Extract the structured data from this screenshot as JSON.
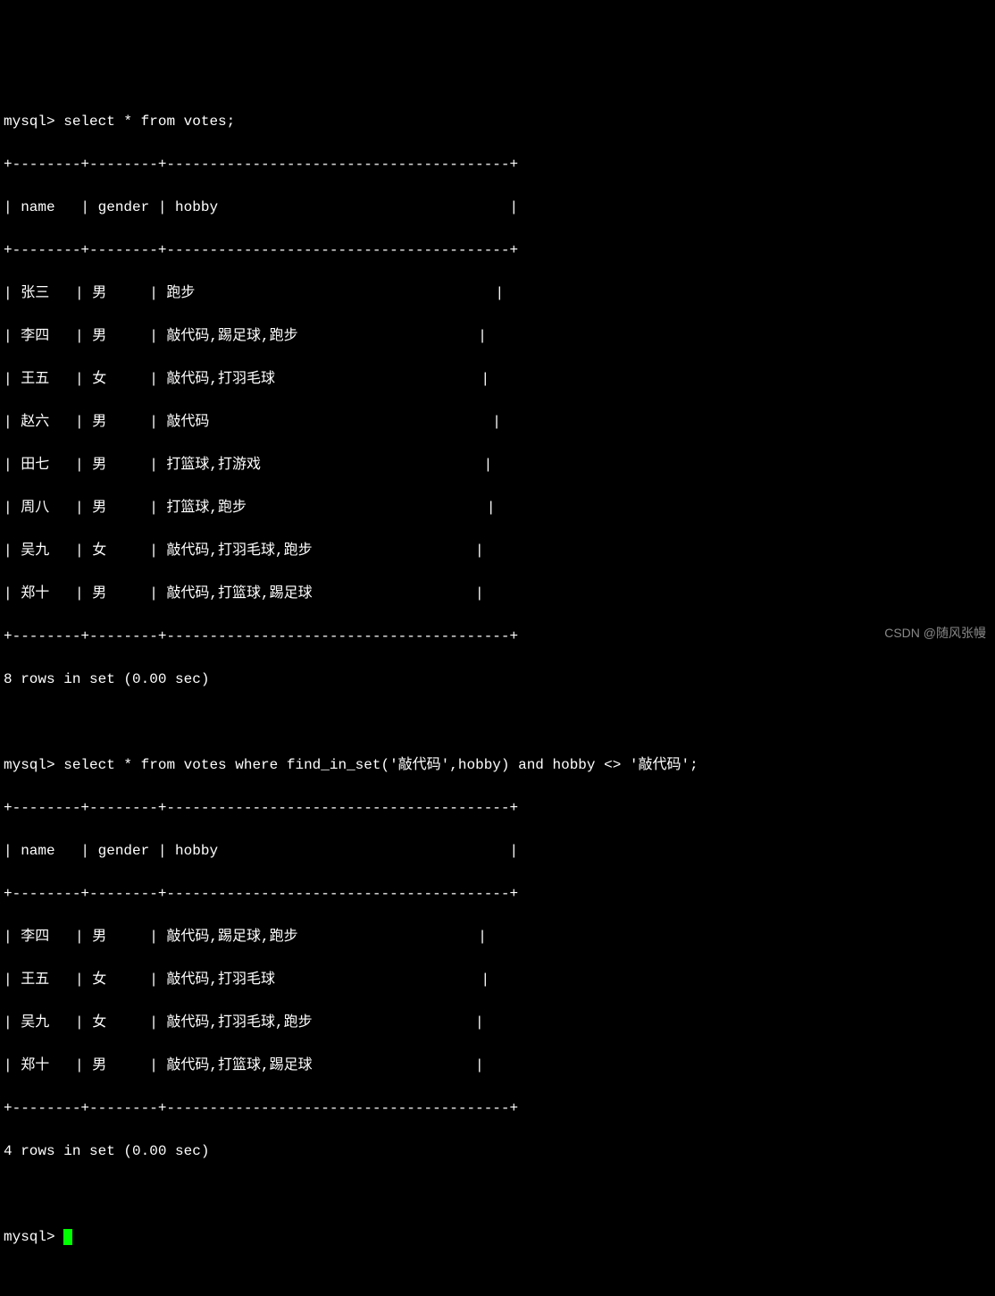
{
  "prompt_label": "mysql>",
  "query1": {
    "text": "select * from votes;",
    "separator": "+--------+--------+----------------------------------------+",
    "header_row": "| name   | gender | hobby                                  |",
    "rows": [
      "| 张三   | 男     | 跑步                                   |",
      "| 李四   | 男     | 敲代码,踢足球,跑步                     |",
      "| 王五   | 女     | 敲代码,打羽毛球                        |",
      "| 赵六   | 男     | 敲代码                                 |",
      "| 田七   | 男     | 打篮球,打游戏                          |",
      "| 周八   | 男     | 打篮球,跑步                            |",
      "| 吴九   | 女     | 敲代码,打羽毛球,跑步                   |",
      "| 郑十   | 男     | 敲代码,打篮球,踢足球                   |"
    ],
    "status": "8 rows in set (0.00 sec)"
  },
  "query2": {
    "text": "select * from votes where find_in_set('敲代码',hobby) and hobby <> '敲代码';",
    "separator": "+--------+--------+----------------------------------------+",
    "header_row": "| name   | gender | hobby                                  |",
    "rows": [
      "| 李四   | 男     | 敲代码,踢足球,跑步                     |",
      "| 王五   | 女     | 敲代码,打羽毛球                        |",
      "| 吴九   | 女     | 敲代码,打羽毛球,跑步                   |",
      "| 郑十   | 男     | 敲代码,打篮球,踢足球                   |"
    ],
    "status": "4 rows in set (0.00 sec)"
  },
  "watermark": "CSDN @随风张幔"
}
